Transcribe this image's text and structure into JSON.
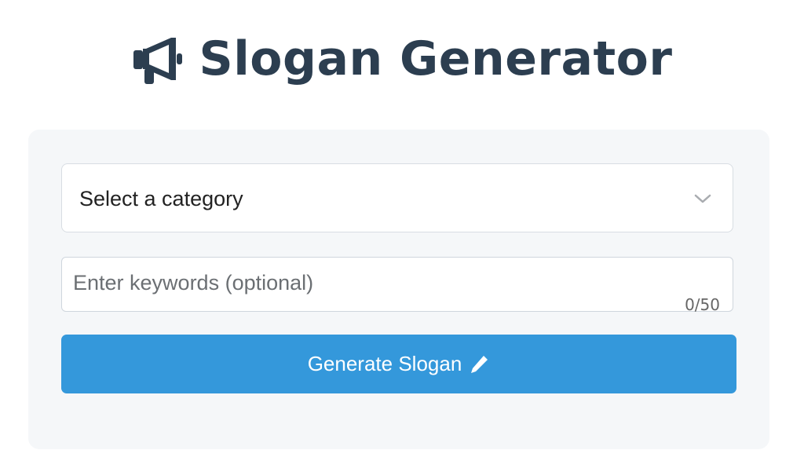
{
  "header": {
    "title": "Slogan Generator",
    "icon": "megaphone-icon"
  },
  "form": {
    "category_select": {
      "selected": "Select a category",
      "icon": "chevron-down-icon"
    },
    "keywords": {
      "value": "",
      "placeholder": "Enter keywords (optional)",
      "counter": "0/50"
    },
    "generate_button": {
      "label": "Generate Slogan",
      "icon": "pencil-icon"
    }
  },
  "colors": {
    "title": "#2c3e50",
    "card_background": "#f5f7f9",
    "button": "#3498db"
  }
}
